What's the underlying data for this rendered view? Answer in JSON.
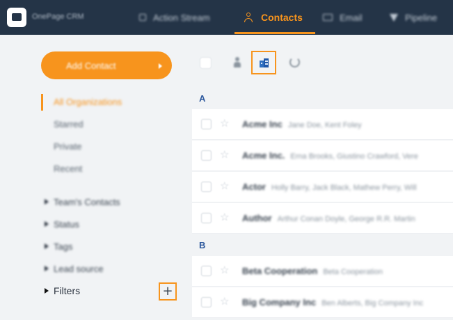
{
  "header": {
    "brand": "OnePage CRM",
    "nav": [
      {
        "label": "Action Stream",
        "icon": "square-icon"
      },
      {
        "label": "Contacts",
        "icon": "person-icon",
        "active": true
      },
      {
        "label": "Email",
        "icon": "mail-icon"
      },
      {
        "label": "Pipeline",
        "icon": "funnel-icon"
      }
    ]
  },
  "sidebar": {
    "add_button": "Add Contact",
    "views": [
      {
        "label": "All Organizations",
        "active": true
      },
      {
        "label": "Starred"
      },
      {
        "label": "Private"
      },
      {
        "label": "Recent"
      }
    ],
    "groups": [
      "Team's Contacts",
      "Status",
      "Tags",
      "Lead source"
    ],
    "filters_label": "Filters",
    "add_filter_symbol": "+"
  },
  "list": {
    "sections": [
      {
        "letter": "A",
        "rows": [
          {
            "name": "Acme Inc",
            "people": "Jane Doe, Kent Foley"
          },
          {
            "name": "Acme Inc.",
            "people": "Erna Brooks, Giustino Crawford, Vere"
          },
          {
            "name": "Actor",
            "people": "Holly Barry, Jack Black, Mathew Perry, Will"
          },
          {
            "name": "Author",
            "people": "Arthur Conan Doyle, George R.R. Martin"
          }
        ]
      },
      {
        "letter": "B",
        "rows": [
          {
            "name": "Beta Cooperation",
            "people": "Beta Cooperation"
          },
          {
            "name": "Big Company Inc",
            "people": "Ben Alberts, Big Company Inc"
          }
        ]
      }
    ]
  },
  "colors": {
    "accent": "#f7941d",
    "topbar": "#243447",
    "section_letter": "#2f5a9e",
    "org_icon": "#1f57a8"
  }
}
